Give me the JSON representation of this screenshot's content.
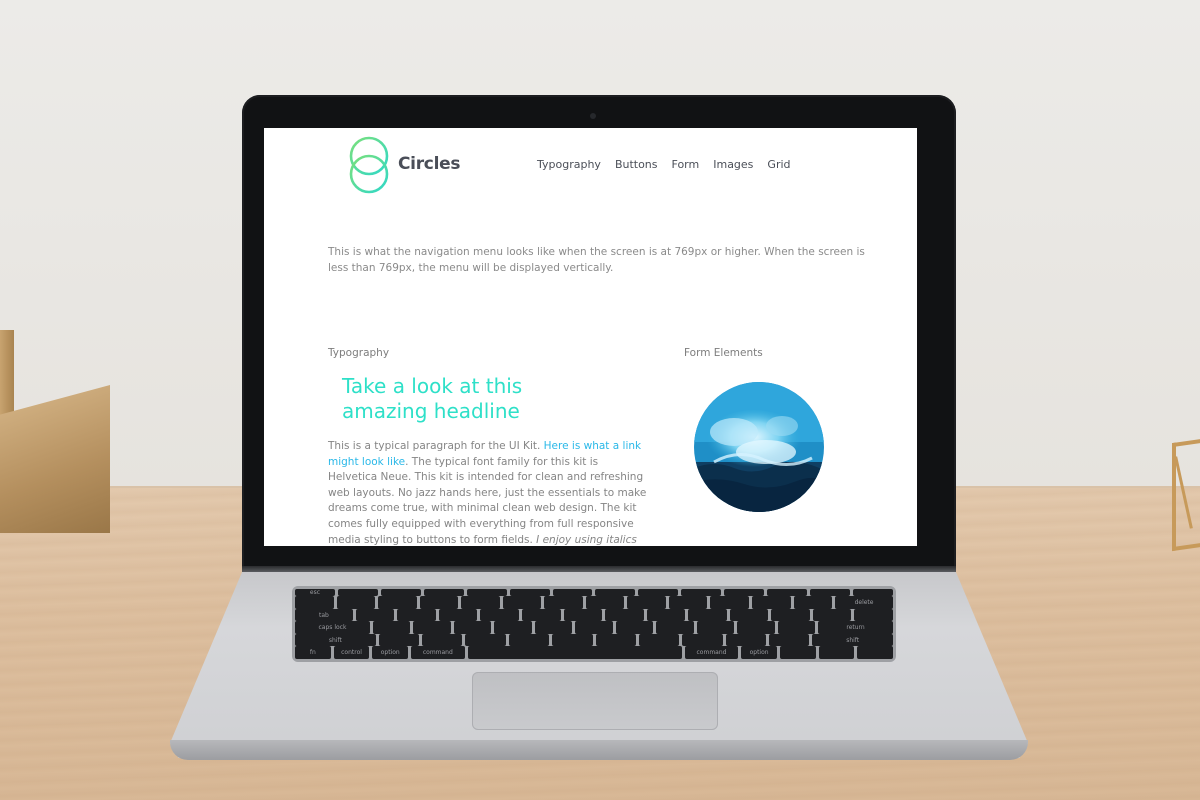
{
  "site": {
    "brand": "Circles",
    "logo_icon": "circles-logo-icon",
    "accent_color": "#2ee0c8",
    "link_color": "#2ab8e8"
  },
  "nav": {
    "items": [
      {
        "label": "Typography"
      },
      {
        "label": "Buttons"
      },
      {
        "label": "Form"
      },
      {
        "label": "Images"
      },
      {
        "label": "Grid"
      }
    ]
  },
  "intro": {
    "text": "This is what the navigation menu looks like when the screen is at 769px or higher. When the screen is less than 769px, the menu will be displayed vertically."
  },
  "typography": {
    "section_label": "Typography",
    "headline": "Take a look at this amazing headline",
    "para_start": "This is a typical paragraph for the UI Kit. ",
    "para_link": "Here is what a link might look like",
    "para_rest": ". The typical font family for this kit is Helvetica Neue. This kit is intended for clean and refreshing web layouts. No jazz hands here, just the essentials to make dreams come true, with minimal clean web design. The kit comes fully equipped with everything from full responsive media styling to buttons to form fields. ",
    "para_italic": "I enjoy using italics as well from time to"
  },
  "form": {
    "section_label": "Form Elements",
    "image_icon": "ocean-wave-image"
  },
  "keyboard": {
    "labels": [
      "esc",
      "tab",
      "caps lock",
      "shift",
      "fn",
      "control",
      "option",
      "command",
      "command",
      "option",
      "delete",
      "return",
      "shift"
    ]
  }
}
